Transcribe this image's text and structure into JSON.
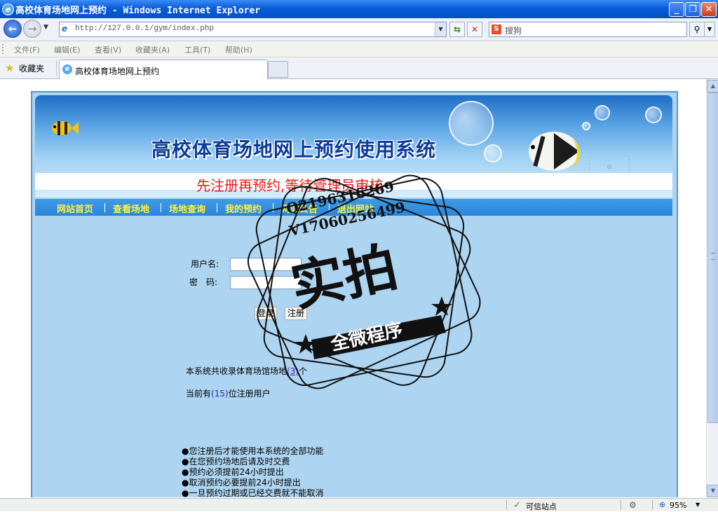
{
  "window": {
    "title": "高校体育场地网上预约 - Windows Internet Explorer",
    "controls": [
      "_",
      "❐",
      "✕"
    ]
  },
  "navigation": {
    "address": "http://127.0.0.1/gym/index.php",
    "search_placeholder": "搜狗"
  },
  "menu": [
    "文件(F)",
    "编辑(E)",
    "查看(V)",
    "收藏夹(A)",
    "工具(T)",
    "帮助(H)"
  ],
  "favorites_label": "收藏夹",
  "tab_title": "高校体育场地网上预约",
  "page": {
    "banner_title": "高校体育场地网上预约使用系统",
    "notice": "先注册再预约,等待管理员审核",
    "nav": [
      "网站首页",
      "查看场地",
      "场地查询",
      "我的预约",
      "网站公告",
      "退出网站"
    ],
    "form": {
      "username_label": "用户名:",
      "password_label": "密　码:",
      "login": "登录",
      "register": "注册"
    },
    "stats": {
      "venues_prefix": "本系统共收录体育场馆场地",
      "venues_count": "(3)",
      "venues_suffix": "个",
      "users_prefix": "当前有",
      "users_count": "(15)",
      "users_suffix": "位注册用户"
    },
    "rules": [
      "●您注册后才能使用本系统的全部功能",
      "●在您预约场地后请及时交费",
      "●预约必须提前24小时提出",
      "●取消预约必要提前24小时提出",
      "●一旦预约过期或已经交费就不能取消"
    ]
  },
  "watermark": {
    "line1": "Q2196316269",
    "line2": "V17060256499",
    "big": "实拍",
    "ribbon": "全微程序"
  },
  "status": {
    "zone": "可信站点",
    "zoom": "95%"
  },
  "colors": {
    "titlebar": "#0a5bd8",
    "site_bg": "#add4f0",
    "nav_bg": "#2b86db",
    "nav_text": "#fff33a",
    "notice_text": "#e8191c",
    "banner_title": "#0c3b9a"
  }
}
